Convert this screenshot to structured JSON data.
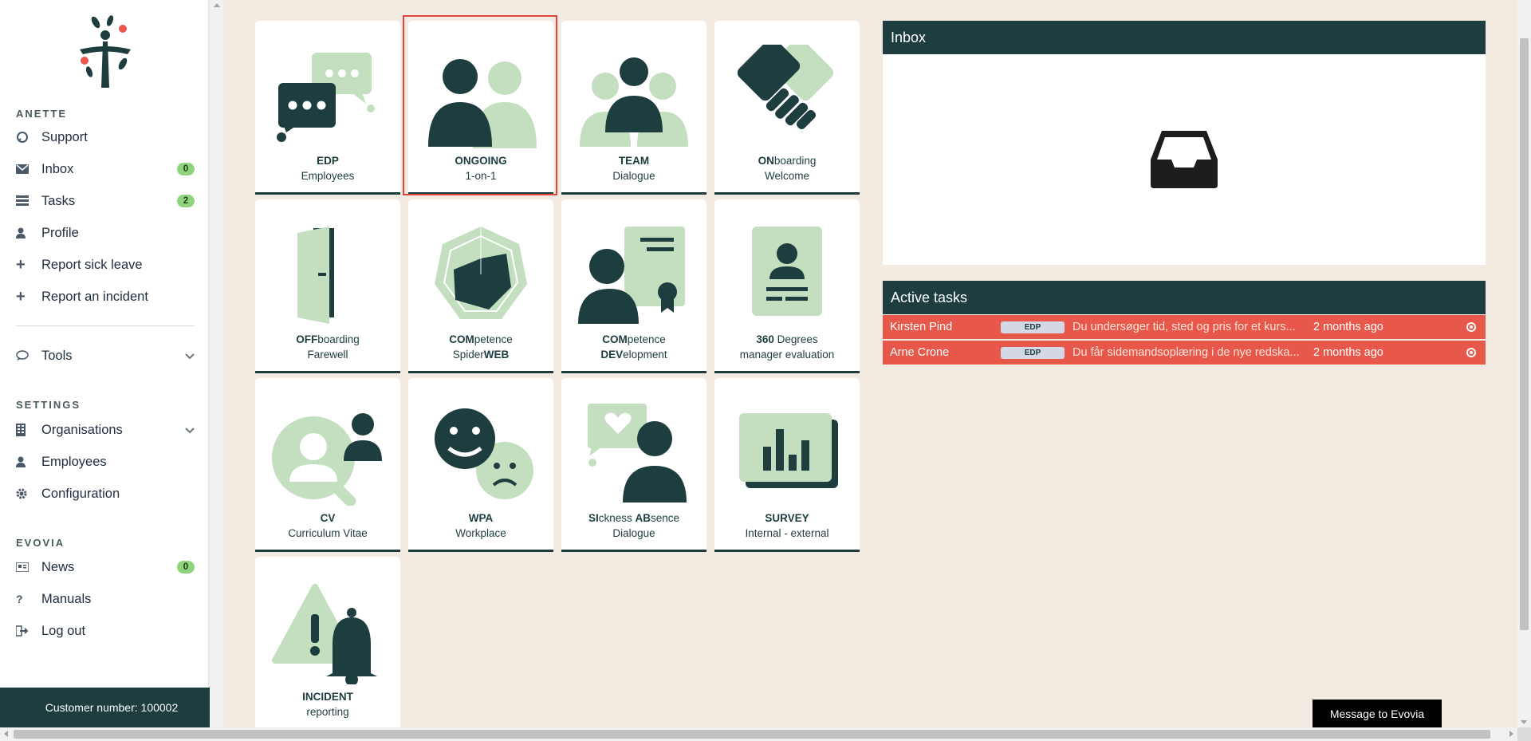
{
  "sidebar": {
    "user_section": "ANETTE",
    "settings_section": "SETTINGS",
    "evovia_section": "EVOVIA",
    "items": [
      {
        "label": "Support",
        "icon": "support-icon"
      },
      {
        "label": "Inbox",
        "icon": "envelope-icon",
        "badge": "0"
      },
      {
        "label": "Tasks",
        "icon": "tasks-icon",
        "badge": "2"
      },
      {
        "label": "Profile",
        "icon": "user-icon"
      },
      {
        "label": "Report sick leave",
        "icon": "plus-icon"
      },
      {
        "label": "Report an incident",
        "icon": "plus-icon"
      },
      {
        "label": "Tools",
        "icon": "chat-icon"
      },
      {
        "label": "Organisations",
        "icon": "building-icon"
      },
      {
        "label": "Employees",
        "icon": "user-icon"
      },
      {
        "label": "Configuration",
        "icon": "gear-icon"
      },
      {
        "label": "News",
        "icon": "newspaper-icon",
        "badge": "0"
      },
      {
        "label": "Manuals",
        "icon": "question-icon"
      },
      {
        "label": "Log out",
        "icon": "logout-icon"
      }
    ],
    "customer_number": "Customer number: 100002"
  },
  "tiles": [
    {
      "bold": "EDP",
      "rest": "",
      "line2": "Employees",
      "line2_bold": ""
    },
    {
      "bold": "ONGOING",
      "rest": "",
      "line2": "1-on-1",
      "line2_bold": ""
    },
    {
      "bold": "TEAM",
      "rest": "",
      "line2": "Dialogue",
      "line2_bold": ""
    },
    {
      "bold": "ON",
      "rest": "boarding",
      "line2": "Welcome",
      "line2_bold": ""
    },
    {
      "bold": "OFF",
      "rest": "boarding",
      "line2": "Farewell",
      "line2_bold": ""
    },
    {
      "bold": "COM",
      "rest": "petence",
      "line2_pre": "Spider",
      "line2_bold": "WEB"
    },
    {
      "bold": "COM",
      "rest": "petence",
      "line2_bold": "DEV",
      "line2": "elopment"
    },
    {
      "bold": "360",
      "rest": " Degrees",
      "line2": "manager evaluation",
      "line2_bold": ""
    },
    {
      "bold": "CV",
      "rest": "",
      "line2": "Curriculum Vitae",
      "line2_bold": ""
    },
    {
      "bold": "WPA",
      "rest": "",
      "line2": "Workplace",
      "line2_bold": ""
    },
    {
      "bold": "SI",
      "rest": "ckness ",
      "bold2": "AB",
      "rest2": "sence",
      "line2": "Dialogue",
      "line2_bold": ""
    },
    {
      "bold": "SURVEY",
      "rest": "",
      "line2": "Internal - external",
      "line2_bold": ""
    },
    {
      "bold": "INCIDENT",
      "rest": "",
      "line2": "reporting",
      "line2_bold": ""
    }
  ],
  "inbox": {
    "title": "Inbox"
  },
  "active_tasks": {
    "title": "Active tasks",
    "rows": [
      {
        "name": "Kirsten Pind",
        "tag": "EDP",
        "desc": "Du undersøger tid, sted og pris for et kurs...",
        "when": "2 months ago"
      },
      {
        "name": "Arne Crone",
        "tag": "EDP",
        "desc": "Du får sidemandsoplæring i de nye redska...",
        "when": "2 months ago"
      }
    ]
  },
  "message_button": "Message to Evovia",
  "colors": {
    "dark_teal": "#1d3d3f",
    "light_green": "#c3dfc0",
    "background": "#f3ebe1",
    "task_red": "#e8584a",
    "badge_green": "#8fd47c",
    "selection_red": "#e0463c"
  }
}
